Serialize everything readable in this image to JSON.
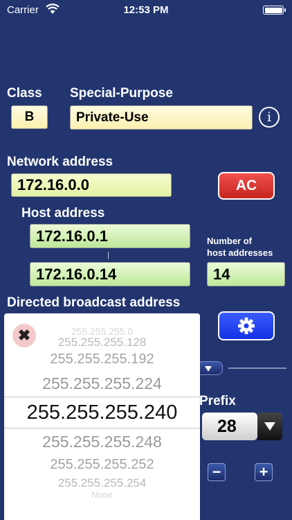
{
  "status_bar": {
    "carrier": "Carrier",
    "time": "12:53 PM"
  },
  "class_label": "Class",
  "class_value": "B",
  "special_purpose_label": "Special-Purpose",
  "special_purpose_value": "Private-Use",
  "info_glyph": "i",
  "network_address_label": "Network address",
  "network_address_value": "172.16.0.0",
  "ac_button_label": "AC",
  "host_address_label": "Host address",
  "host_first": "172.16.0.1",
  "host_last": "172.16.0.14",
  "host_range_separator": "|",
  "number_of_hosts_label_line1": "Number of",
  "number_of_hosts_label_line2": "host addresses",
  "number_of_hosts_value": "14",
  "directed_broadcast_label": "Directed broadcast address",
  "prefix_label": "Prefix",
  "prefix_value": "28",
  "stepper_minus": "−",
  "stepper_plus": "+",
  "close_glyph": "✖",
  "subnet_mask_picker": {
    "options": [
      "255.255.255.0",
      "255.255.255.128",
      "255.255.255.192",
      "255.255.255.224",
      "255.255.255.240",
      "255.255.255.248",
      "255.255.255.252",
      "255.255.255.254",
      "None"
    ],
    "selected": "255.255.255.240"
  },
  "colors": {
    "background": "#22356f",
    "ac_button": "#d9322d",
    "settings_button": "#1f3ef2",
    "field_green": "#c6eca6",
    "field_yellow": "#fbf3c4"
  }
}
